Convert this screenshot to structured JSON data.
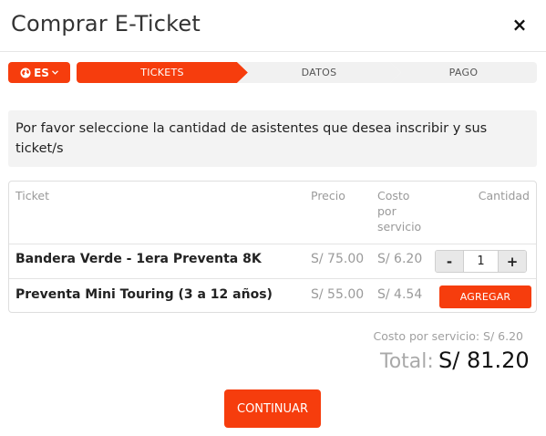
{
  "modal": {
    "title": "Comprar E-Ticket",
    "close_icon": "×"
  },
  "language": {
    "label": "ES",
    "icon": "globe-icon",
    "chevron": "chevron-down-icon"
  },
  "steps": [
    {
      "label": "TICKETS",
      "active": true
    },
    {
      "label": "DATOS",
      "active": false
    },
    {
      "label": "PAGO",
      "active": false
    }
  ],
  "info": {
    "text": "Por favor seleccione la cantidad de asistentes que desea inscribir y sus ticket/s"
  },
  "table": {
    "headers": {
      "ticket": "Ticket",
      "precio": "Precio",
      "costo": [
        "Costo",
        "por",
        "servicio"
      ],
      "cantidad": "Cantidad"
    },
    "rows": [
      {
        "name": "Bandera Verde - 1era Preventa 8K",
        "price": "S/ 75.00",
        "service": "S/ 6.20",
        "quantity": "1",
        "minus": "-",
        "plus": "+"
      },
      {
        "name": "Preventa Mini Touring (3 a 12 años)",
        "price": "S/ 55.00",
        "service": "S/ 4.54",
        "action": "AGREGAR"
      }
    ]
  },
  "summary": {
    "service_cost": "Costo por servicio: S/ 6.20",
    "total_label": "Total:",
    "total_value": "S/ 81.20"
  },
  "footer": {
    "continue_label": "CONTINUAR"
  },
  "colors": {
    "accent": "#f63d0d",
    "muted_text": "#9a9a9a",
    "step_inactive": "#f1f1f1"
  }
}
